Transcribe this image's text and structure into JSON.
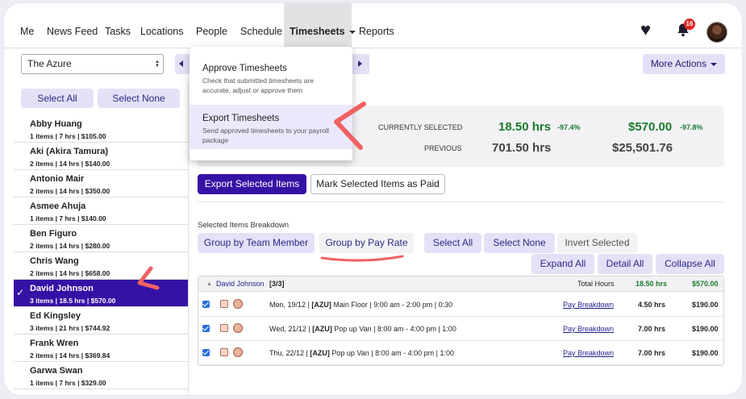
{
  "nav": {
    "items": [
      "Me",
      "News Feed",
      "Tasks",
      "Locations",
      "People",
      "Schedule"
    ],
    "active": "Timesheets",
    "after": "Reports",
    "notif_count": "16"
  },
  "location": {
    "value": "The Azure"
  },
  "more_actions": "More Actions",
  "people_buttons": {
    "select_all": "Select All",
    "select_none": "Select None"
  },
  "people": [
    {
      "name": "Abby Huang",
      "meta": "1 items | 7 hrs | $105.00"
    },
    {
      "name": "Aki (Akira Tamura)",
      "meta": "2 items | 14 hrs | $140.00"
    },
    {
      "name": "Antonio Mair",
      "meta": "2 items | 14 hrs | $350.00"
    },
    {
      "name": "Asmee Ahuja",
      "meta": "1 items | 7 hrs | $140.00"
    },
    {
      "name": "Ben Figuro",
      "meta": "2 items | 14 hrs | $280.00"
    },
    {
      "name": "Chris Wang",
      "meta": "2 items | 14 hrs | $658.00"
    },
    {
      "name": "David Johnson",
      "meta": "3 items | 18.5 hrs | $570.00"
    },
    {
      "name": "Ed Kingsley",
      "meta": "3 items | 21 hrs | $744.92"
    },
    {
      "name": "Frank Wren",
      "meta": "2 items | 14 hrs | $369.84"
    },
    {
      "name": "Garwa Swan",
      "meta": "1 items | 7 hrs | $329.00"
    }
  ],
  "selected_person": "David Johnson",
  "dropdown": {
    "approve": {
      "title": "Approve Timesheets",
      "desc": "Check that submitted timesheets are accurate, adjust or approve them"
    },
    "export": {
      "title": "Export Timesheets",
      "desc": "Send approved timesheets to your payroll package"
    }
  },
  "stats": {
    "current_label": "CURRENTLY SELECTED",
    "previous_label": "PREVIOUS",
    "current_hrs": "18.50 hrs",
    "current_hrs_pct": "-97.4%",
    "current_amt": "$570.00",
    "current_amt_pct": "-97.8%",
    "prev_hrs": "701.50 hrs",
    "prev_amt": "$25,501.76"
  },
  "actions": {
    "export": "Export Selected Items",
    "mark_paid": "Mark Selected Items as Paid"
  },
  "breakdown": {
    "label": "Selected Items Breakdown",
    "group_team": "Group by Team Member",
    "group_rate": "Group by Pay Rate",
    "select_all": "Select All",
    "select_none": "Select None",
    "invert": "Invert Selected",
    "expand_all": "Expand All",
    "detail_all": "Detail All",
    "collapse_all": "Collapse All"
  },
  "group": {
    "name": "David Johnson",
    "count": "[3/3]",
    "total_label": "Total Hours",
    "total_hrs": "18.50 hrs",
    "total_amt": "$570.00"
  },
  "entries": [
    {
      "prefix": "Mon, 19/12 | ",
      "code": "[AZU]",
      "desc": " Main Floor | 9:00 am - 2:00 pm | 0:30",
      "link": "Pay Breakdown",
      "hrs": "4.50 hrs",
      "amt": "$190.00"
    },
    {
      "prefix": "Wed, 21/12 | ",
      "code": "[AZU]",
      "desc": " Pop up Van | 8:00 am - 4:00 pm | 1:00",
      "link": "Pay Breakdown",
      "hrs": "7.00 hrs",
      "amt": "$190.00"
    },
    {
      "prefix": "Thu, 22/12 | ",
      "code": "[AZU]",
      "desc": " Pop up Van | 8:00 am - 4:00 pm | 1:00",
      "link": "Pay Breakdown",
      "hrs": "7.00 hrs",
      "amt": "$190.00"
    }
  ],
  "colors": {
    "primary": "#3512a6",
    "light": "#e4e1f7",
    "green": "#1c7a2e",
    "annotation": "#f06262"
  }
}
